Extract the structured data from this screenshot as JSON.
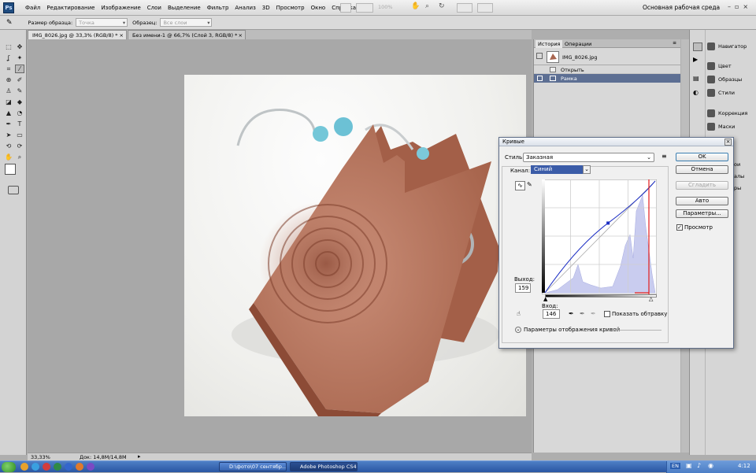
{
  "app": {
    "logo": "Ps",
    "workspace": "Основная рабочая среда",
    "zoom_selector": "100%"
  },
  "menu": [
    "Файл",
    "Редактирование",
    "Изображение",
    "Слои",
    "Выделение",
    "Фильтр",
    "Анализ",
    "3D",
    "Просмотр",
    "Окно",
    "Справка"
  ],
  "options_bar": {
    "sample_size_label": "Размер образца:",
    "sample_size_value": "Точка",
    "sample_label": "Образец:",
    "sample_value": "Все слои"
  },
  "tabs": [
    {
      "label": "IMG_8026.jpg @ 33,3% (RGB/8) *",
      "close": "×"
    },
    {
      "label": "Без имени-1 @ 66,7% (Слой 3, RGB/8) *",
      "close": "×"
    }
  ],
  "status": {
    "zoom": "33,33%",
    "doc": "Док: 14,8M/14,8M"
  },
  "history_panel": {
    "tabs": [
      "История",
      "Операции"
    ],
    "snapshot": "IMG_8026.jpg",
    "steps": [
      "Открыть",
      "Рамка"
    ]
  },
  "dock": {
    "items": [
      "Навигатор",
      "Цвет",
      "Образцы",
      "Стили",
      "Коррекция",
      "Маски"
    ],
    "partial_items": [
      "ои",
      "алы",
      "ры"
    ]
  },
  "curves_dialog": {
    "title": "Кривые",
    "close": "×",
    "style_label": "Стиль:",
    "style_value": "Заказная",
    "channel_label": "Канал:",
    "channel_value": "Синий",
    "output_label": "Выход:",
    "output_value": "159",
    "input_label": "Вход:",
    "input_value": "146",
    "show_clipping_label": "Показать обтравку",
    "show_clipping_checked": false,
    "display_options_label": "Параметры отображения кривой",
    "buttons": {
      "ok": "OK",
      "cancel": "Отмена",
      "smooth": "Сгладить",
      "auto": "Авто",
      "options": "Параметры..."
    },
    "preview_label": "Просмотр",
    "preview_checked": true,
    "curve_point": {
      "input": 146,
      "output": 159
    }
  },
  "taskbar": {
    "tasks": [
      "D:\\фото\\07 сентябр...",
      "Adobe Photoshop CS4..."
    ],
    "language": "EN",
    "clock": "4:12"
  },
  "colors": {
    "accent": "#1f4c80",
    "selection": "#5d6f93",
    "histogram": "#c9ccef",
    "curve": "#1d2fc4"
  }
}
